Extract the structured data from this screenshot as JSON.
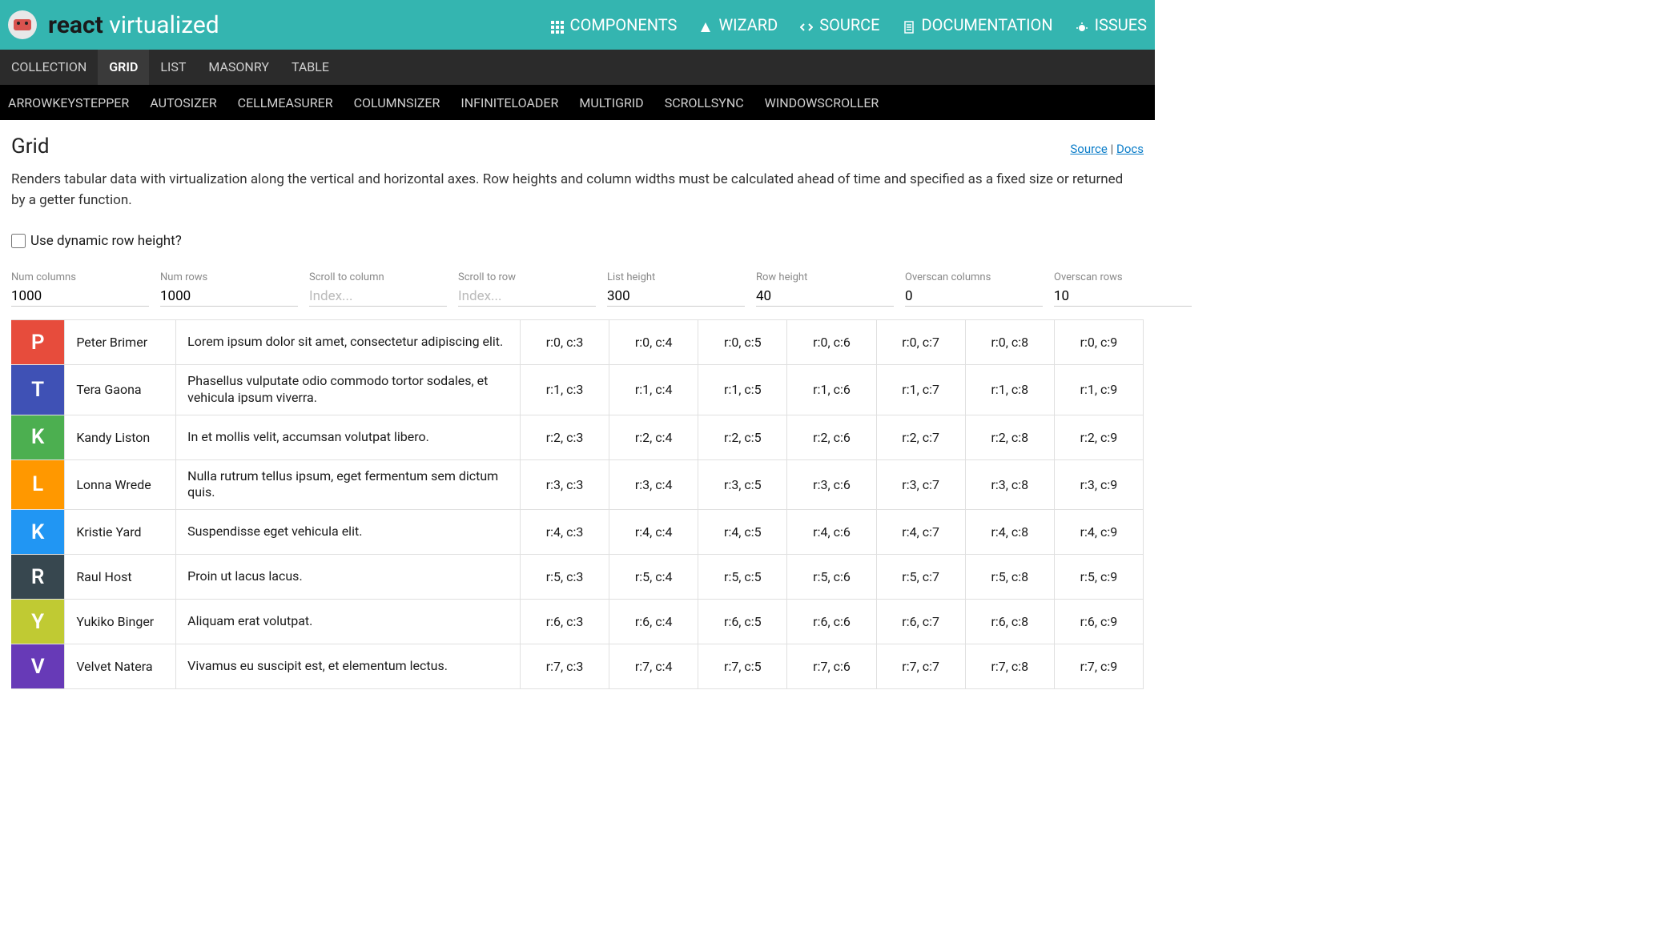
{
  "brand": {
    "dark": "react",
    "light": "virtualized"
  },
  "header_nav": [
    {
      "label": "COMPONENTS",
      "icon": "grid"
    },
    {
      "label": "WIZARD",
      "icon": "triangle"
    },
    {
      "label": "SOURCE",
      "icon": "code"
    },
    {
      "label": "DOCUMENTATION",
      "icon": "doc"
    },
    {
      "label": "ISSUES",
      "icon": "bug"
    }
  ],
  "nav1": [
    "COLLECTION",
    "GRID",
    "LIST",
    "MASONRY",
    "TABLE"
  ],
  "nav1_active": "GRID",
  "nav2": [
    "ARROWKEYSTEPPER",
    "AUTOSIZER",
    "CELLMEASURER",
    "COLUMNSIZER",
    "INFINITELOADER",
    "MULTIGRID",
    "SCROLLSYNC",
    "WINDOWSCROLLER"
  ],
  "page": {
    "title": "Grid",
    "source": "Source",
    "sep": "|",
    "docs": "Docs",
    "description": "Renders tabular data with virtualization along the vertical and horizontal axes. Row heights and column widths must be calculated ahead of time and specified as a fixed size or returned by a getter function."
  },
  "checkbox": {
    "label": "Use dynamic row height?",
    "checked": false
  },
  "controls": [
    {
      "label": "Num columns",
      "value": "1000",
      "placeholder": ""
    },
    {
      "label": "Num rows",
      "value": "1000",
      "placeholder": ""
    },
    {
      "label": "Scroll to column",
      "value": "",
      "placeholder": "Index..."
    },
    {
      "label": "Scroll to row",
      "value": "",
      "placeholder": "Index..."
    },
    {
      "label": "List height",
      "value": "300",
      "placeholder": ""
    },
    {
      "label": "Row height",
      "value": "40",
      "placeholder": ""
    },
    {
      "label": "Overscan columns",
      "value": "0",
      "placeholder": ""
    },
    {
      "label": "Overscan rows",
      "value": "10",
      "placeholder": ""
    }
  ],
  "rows": [
    {
      "r": 0,
      "letter": "P",
      "color": "red",
      "name": "Peter Brimer",
      "desc": "Lorem ipsum dolor sit amet, consectetur adipiscing elit."
    },
    {
      "r": 1,
      "letter": "T",
      "color": "blue",
      "name": "Tera Gaona",
      "desc": "Phasellus vulputate odio commodo tortor sodales, et vehicula ipsum viverra."
    },
    {
      "r": 2,
      "letter": "K",
      "color": "green",
      "name": "Kandy Liston",
      "desc": "In et mollis velit, accumsan volutpat libero."
    },
    {
      "r": 3,
      "letter": "L",
      "color": "orange",
      "name": "Lonna Wrede",
      "desc": "Nulla rutrum tellus ipsum, eget fermentum sem dictum quis."
    },
    {
      "r": 4,
      "letter": "K",
      "color": "lblue",
      "name": "Kristie Yard",
      "desc": "Suspendisse eget vehicula elit."
    },
    {
      "r": 5,
      "letter": "R",
      "color": "dark",
      "name": "Raul Host",
      "desc": "Proin ut lacus lacus."
    },
    {
      "r": 6,
      "letter": "Y",
      "color": "lime",
      "name": "Yukiko Binger",
      "desc": "Aliquam erat volutpat."
    },
    {
      "r": 7,
      "letter": "V",
      "color": "purple",
      "name": "Velvet Natera",
      "desc": "Vivamus eu suscipit est, et elementum lectus."
    }
  ],
  "rc_cols": [
    3,
    4,
    5,
    6,
    7,
    8,
    9
  ]
}
